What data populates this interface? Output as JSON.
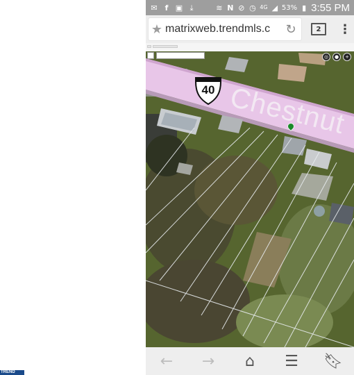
{
  "status_bar": {
    "battery_percent": "53%",
    "time": "3:55 PM",
    "icons": [
      "mail-icon",
      "facebook-icon",
      "gallery-icon",
      "download-icon",
      "wifi-icon",
      "nfc-icon",
      "mute-icon",
      "alarm-icon",
      "lte-icon",
      "signal-icon",
      "battery-icon"
    ]
  },
  "browser": {
    "url": "matrixweb.trendmls.c",
    "tab_count": "2"
  },
  "map": {
    "route_number": "40",
    "street_label": "Chestnut"
  },
  "bottom_nav": {
    "icons": [
      "back-icon",
      "forward-icon",
      "home-icon",
      "reader-icon",
      "bookmark-icon"
    ]
  },
  "watermark": {
    "text": "TREND"
  }
}
